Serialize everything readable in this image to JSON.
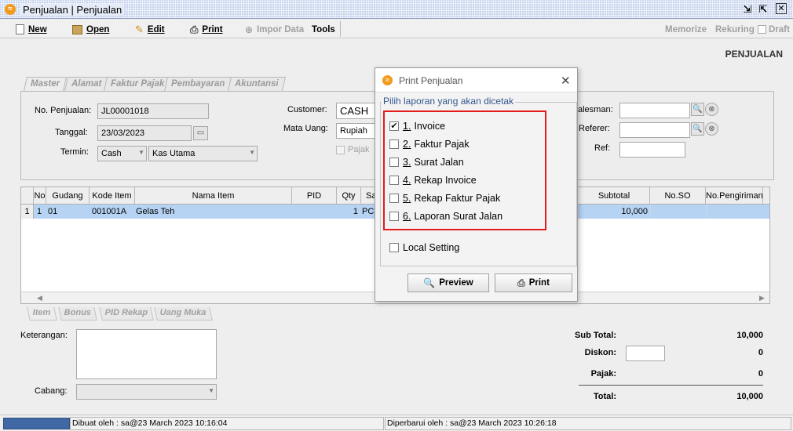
{
  "window": {
    "title": "Penjualan | Penjualan",
    "icons": {
      "app": "app-logo-icon",
      "restore": "restore-icon",
      "maximize": "maximize-icon",
      "close": "close-icon"
    }
  },
  "toolbar": {
    "new_label": "New",
    "open_label": "Open",
    "edit_label": "Edit",
    "print_label": "Print",
    "impor_label": "Impor Data",
    "tools_label": "Tools",
    "memorize_label": "Memorize",
    "rekuring_label": "Rekuring",
    "draft_label": "Draft"
  },
  "page": {
    "heading": "PENJUALAN"
  },
  "tabs": [
    "Master",
    "Alamat",
    "Faktur Pajak",
    "Pembayaran",
    "Akuntansi"
  ],
  "form": {
    "no_penjualan_label": "No. Penjualan:",
    "no_penjualan_value": "JL00001018",
    "tanggal_label": "Tanggal:",
    "tanggal_value": "23/03/2023",
    "termin_label": "Termin:",
    "termin_value": "Cash",
    "kas_value": "Kas Utama",
    "customer_label": "Customer:",
    "customer_value": "CASH",
    "mata_uang_label": "Mata Uang:",
    "mata_uang_value": "Rupiah",
    "pajak_label": "Pajak",
    "salesman_label": "alesman:",
    "salesman_value": "",
    "referer_label": "Referer:",
    "referer_value": "",
    "ref_label": "Ref:",
    "ref_value": ""
  },
  "grid": {
    "columns": [
      "No",
      "Gudang",
      "Kode Item",
      "Nama Item",
      "PID",
      "Qty",
      "Sa",
      "Subtotal",
      "No.SO",
      "No.Pengiriman"
    ],
    "rows": [
      {
        "row_header": "1",
        "no": "1",
        "gudang": "01",
        "kode_item": "001001A",
        "nama_item": "Gelas Teh",
        "pid": "",
        "qty": "1",
        "satuan": "PCS",
        "subtotal": "10,000",
        "no_so": "",
        "no_pengiriman": ""
      }
    ]
  },
  "bottom_tabs": [
    "Item",
    "Bonus",
    "PID Rekap",
    "Uang Muka"
  ],
  "bottom": {
    "keterangan_label": "Keterangan:",
    "keterangan_value": "",
    "cabang_label": "Cabang:",
    "cabang_value": ""
  },
  "summary": {
    "sub_total_label": "Sub Total:",
    "sub_total_value": "10,000",
    "diskon_label": "Diskon:",
    "diskon_input": "",
    "diskon_value": "0",
    "pajak_label": "Pajak:",
    "pajak_value": "0",
    "total_label": "Total:",
    "total_value": "10,000"
  },
  "status": {
    "dibuat": "Dibuat oleh : sa@23 March 2023  10:16:04",
    "diperbarui": "Diperbarui oleh : sa@23 March 2023  10:26:18"
  },
  "dialog": {
    "title": "Print Penjualan",
    "group_label": "Pilih laporan yang akan dicetak",
    "options": [
      {
        "num": "1.",
        "label": "Invoice",
        "checked": true
      },
      {
        "num": "2.",
        "label": "Faktur Pajak",
        "checked": false
      },
      {
        "num": "3.",
        "label": "Surat Jalan",
        "checked": false
      },
      {
        "num": "4.",
        "label": "Rekap Invoice",
        "checked": false
      },
      {
        "num": "5.",
        "label": "Rekap Faktur Pajak",
        "checked": false
      },
      {
        "num": "6.",
        "label": "Laporan Surat Jalan",
        "checked": false
      }
    ],
    "local_setting_label": "Local Setting",
    "preview_label": "Preview",
    "print_label": "Print",
    "highlight_color": "#e31b1b"
  }
}
